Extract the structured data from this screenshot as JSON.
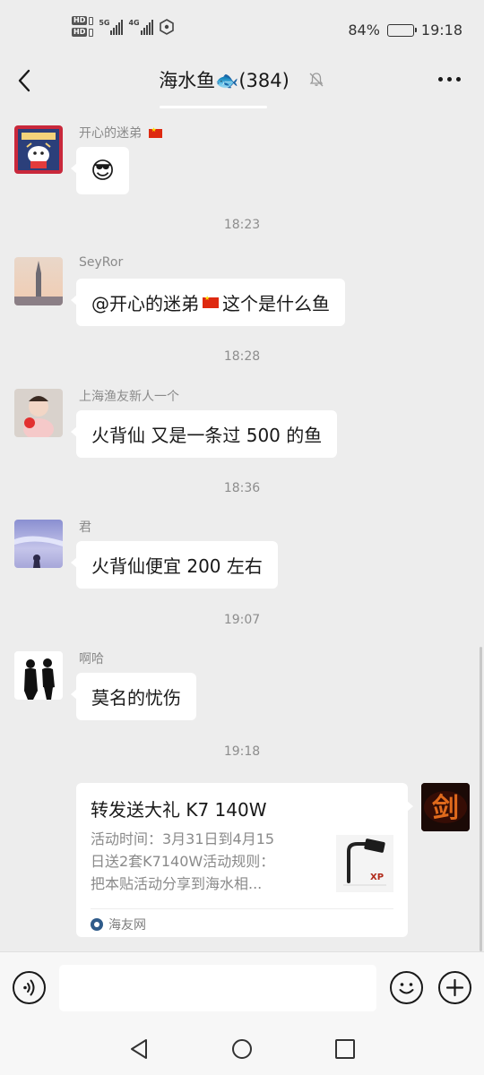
{
  "status_bar": {
    "hd1": "HD",
    "hd2": "HD",
    "net1": "5G",
    "net2": "4G",
    "battery_text": "84%",
    "battery_level": 0.84,
    "time": "19:18"
  },
  "header": {
    "title": "海水鱼🐟(384)",
    "mute_icon": "bell-muted-icon",
    "more_icon": "more-dots-icon"
  },
  "messages": [
    {
      "sender": "开心的迷弟",
      "sender_flag": true,
      "text": "😎"
    },
    {
      "time": "18:23"
    },
    {
      "sender": "SeyRor",
      "mention": "@开心的迷弟",
      "text": " 这个是什么鱼"
    },
    {
      "time": "18:28"
    },
    {
      "sender": "上海渔友新人一个",
      "text": "火背仙  又是一条过 500 的鱼"
    },
    {
      "time": "18:36"
    },
    {
      "sender": "君",
      "text": "火背仙便宜  200 左右"
    },
    {
      "time": "19:07"
    },
    {
      "sender": "啊哈",
      "text": "莫名的忧伤"
    },
    {
      "time": "19:18"
    }
  ],
  "link_card": {
    "title": "转发送大礼 K7 140W",
    "desc_lines": [
      "活动时间：3月31日到4月15",
      "日送2套K7140W活动规则：",
      "把本贴活动分享到海水相..."
    ],
    "source": "海友网",
    "thumb_logo": "XP"
  },
  "my_avatar": {
    "glyph": "剑"
  },
  "input_bar": {
    "placeholder": "",
    "voice_icon": "voice-icon",
    "emoji_icon": "emoji-icon",
    "plus_icon": "plus-icon"
  },
  "system_nav": {
    "back": "nav-back-icon",
    "home": "nav-home-icon",
    "recent": "nav-recent-icon"
  }
}
